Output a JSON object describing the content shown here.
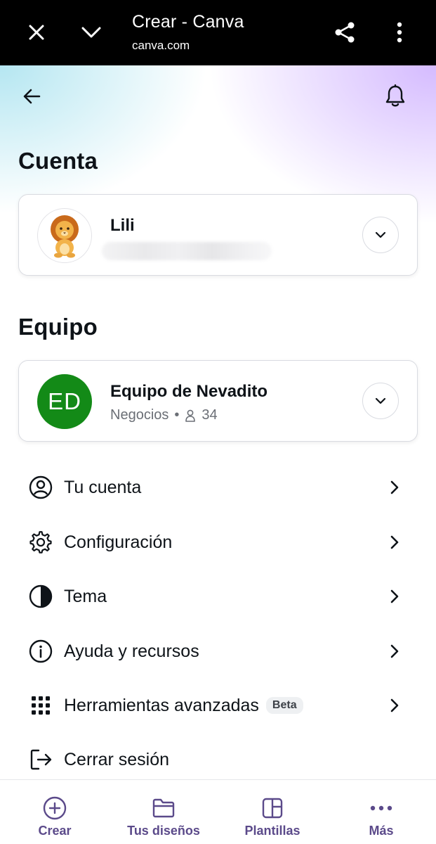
{
  "browser": {
    "title": "Crear - Canva",
    "url": "canva.com",
    "icons": [
      "close-icon",
      "chevron-down-icon",
      "share-icon",
      "more-vert-icon"
    ]
  },
  "header": {
    "icons": [
      "back-arrow-icon",
      "bell-icon"
    ]
  },
  "account": {
    "section_title": "Cuenta",
    "name": "Lili",
    "avatar": "lion-avatar"
  },
  "team": {
    "section_title": "Equipo",
    "initials": "ED",
    "name": "Equipo de Nevadito",
    "plan": "Negocios",
    "separator": "•",
    "members": "34",
    "avatar_color": "#138a17"
  },
  "menu": {
    "items": [
      {
        "label": "Tu cuenta",
        "icon": "user-circle-icon"
      },
      {
        "label": "Configuración",
        "icon": "gear-icon"
      },
      {
        "label": "Tema",
        "icon": "contrast-icon"
      },
      {
        "label": "Ayuda y recursos",
        "icon": "info-icon"
      },
      {
        "label": "Herramientas avanzadas",
        "icon": "grid-icon",
        "badge": "Beta"
      },
      {
        "label": "Cerrar sesión",
        "icon": "logout-icon"
      }
    ]
  },
  "bottom_nav": {
    "items": [
      {
        "label": "Crear",
        "icon": "plus-circle-icon"
      },
      {
        "label": "Tus diseños",
        "icon": "folder-icon"
      },
      {
        "label": "Plantillas",
        "icon": "template-icon"
      },
      {
        "label": "Más",
        "icon": "more-horiz-icon"
      }
    ],
    "color": "#5b4a8a"
  }
}
